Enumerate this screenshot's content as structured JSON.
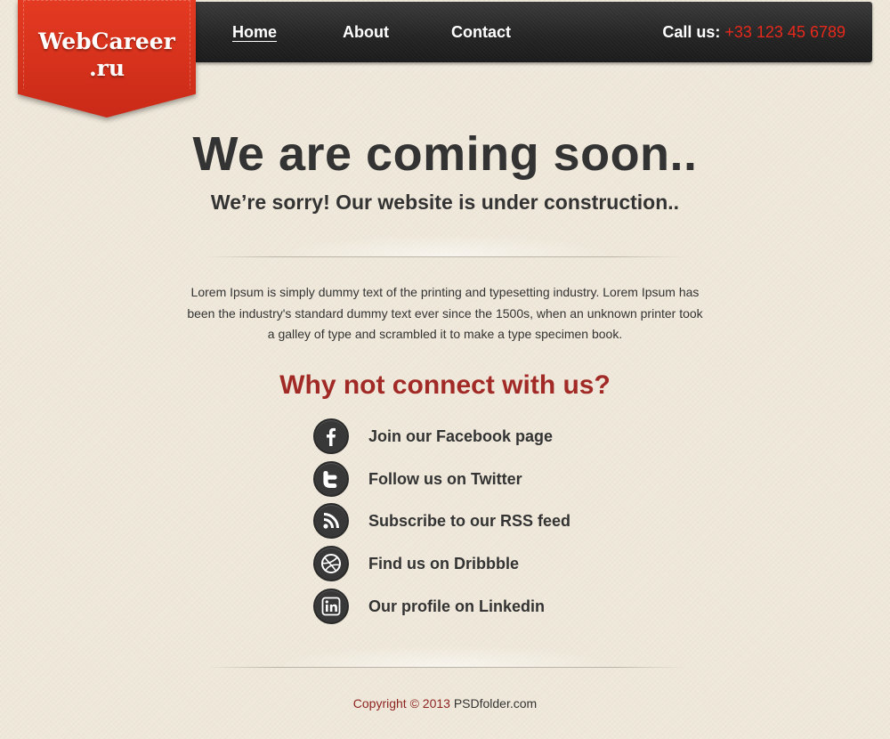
{
  "brand": {
    "line1": "WebCareer",
    "line2": ".ru",
    "color": "#d8321c"
  },
  "nav": {
    "items": [
      {
        "label": "Home",
        "active": true
      },
      {
        "label": "About",
        "active": false
      },
      {
        "label": "Contact",
        "active": false
      }
    ]
  },
  "header": {
    "call_label": "Call us:",
    "phone": "+33 123 45 6789"
  },
  "main": {
    "headline": "We are coming soon..",
    "subheadline": "We’re sorry! Our website is under construction..",
    "body": "Lorem Ipsum is simply dummy text of the printing and typesetting industry. Lorem Ipsum has been the industry's standard dummy text ever since the 1500s, when an unknown printer took a galley of type and scrambled it to make a type specimen book.",
    "connect_title": "Why not connect with us?"
  },
  "social": [
    {
      "icon": "facebook-icon",
      "label": "Join our Facebook page"
    },
    {
      "icon": "twitter-icon",
      "label": "Follow us on Twitter"
    },
    {
      "icon": "rss-icon",
      "label": "Subscribe to our RSS feed"
    },
    {
      "icon": "dribbble-icon",
      "label": "Find us on Dribbble"
    },
    {
      "icon": "linkedin-icon",
      "label": "Our profile on Linkedin"
    }
  ],
  "footer": {
    "copyright": "Copyright © 2013",
    "site": "PSDfolder.com"
  },
  "colors": {
    "accent": "#e6291c",
    "headline_red": "#a12a26",
    "background": "#efe8da",
    "header_bar": "#262626"
  }
}
